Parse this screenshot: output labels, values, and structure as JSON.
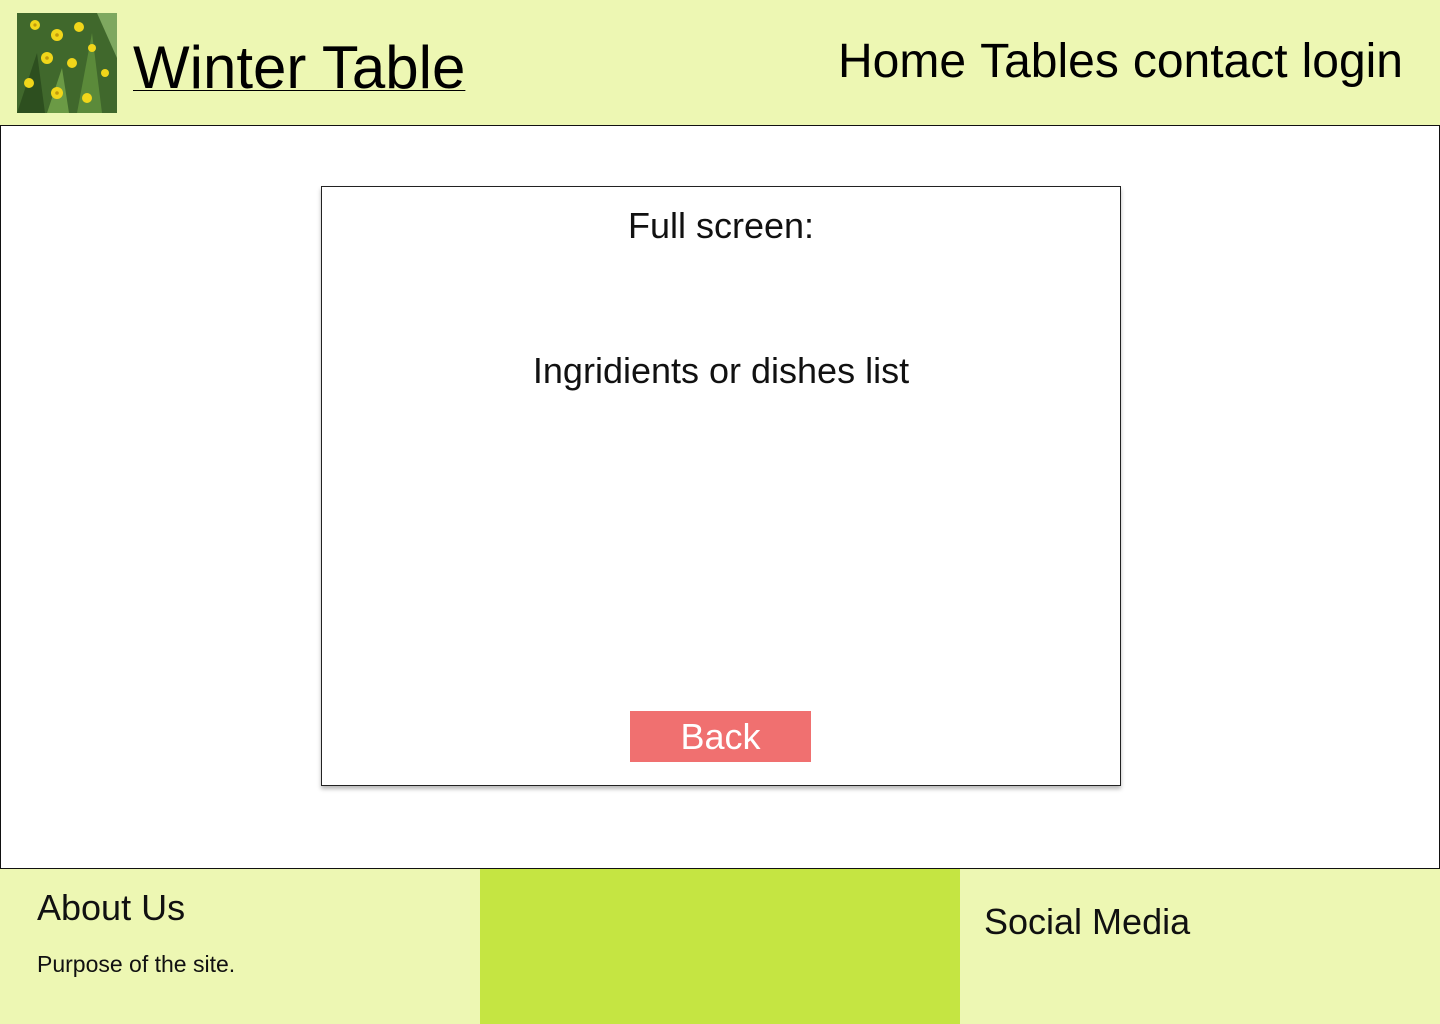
{
  "header": {
    "logo_alt": "yellow flowers photo",
    "site_title": "Winter Table",
    "nav": [
      "Home",
      "Tables",
      "contact",
      "login"
    ]
  },
  "modal": {
    "title": "Full screen:",
    "body_text": "Ingridients or dishes list",
    "back_label": "Back"
  },
  "footer": {
    "about_heading": "About Us",
    "about_text": "Purpose of the site.",
    "social_heading": "Social Media"
  },
  "colors": {
    "header_bg": "#edf7b3",
    "footer_center_bg": "#c5e542",
    "back_button_bg": "#f07070"
  }
}
